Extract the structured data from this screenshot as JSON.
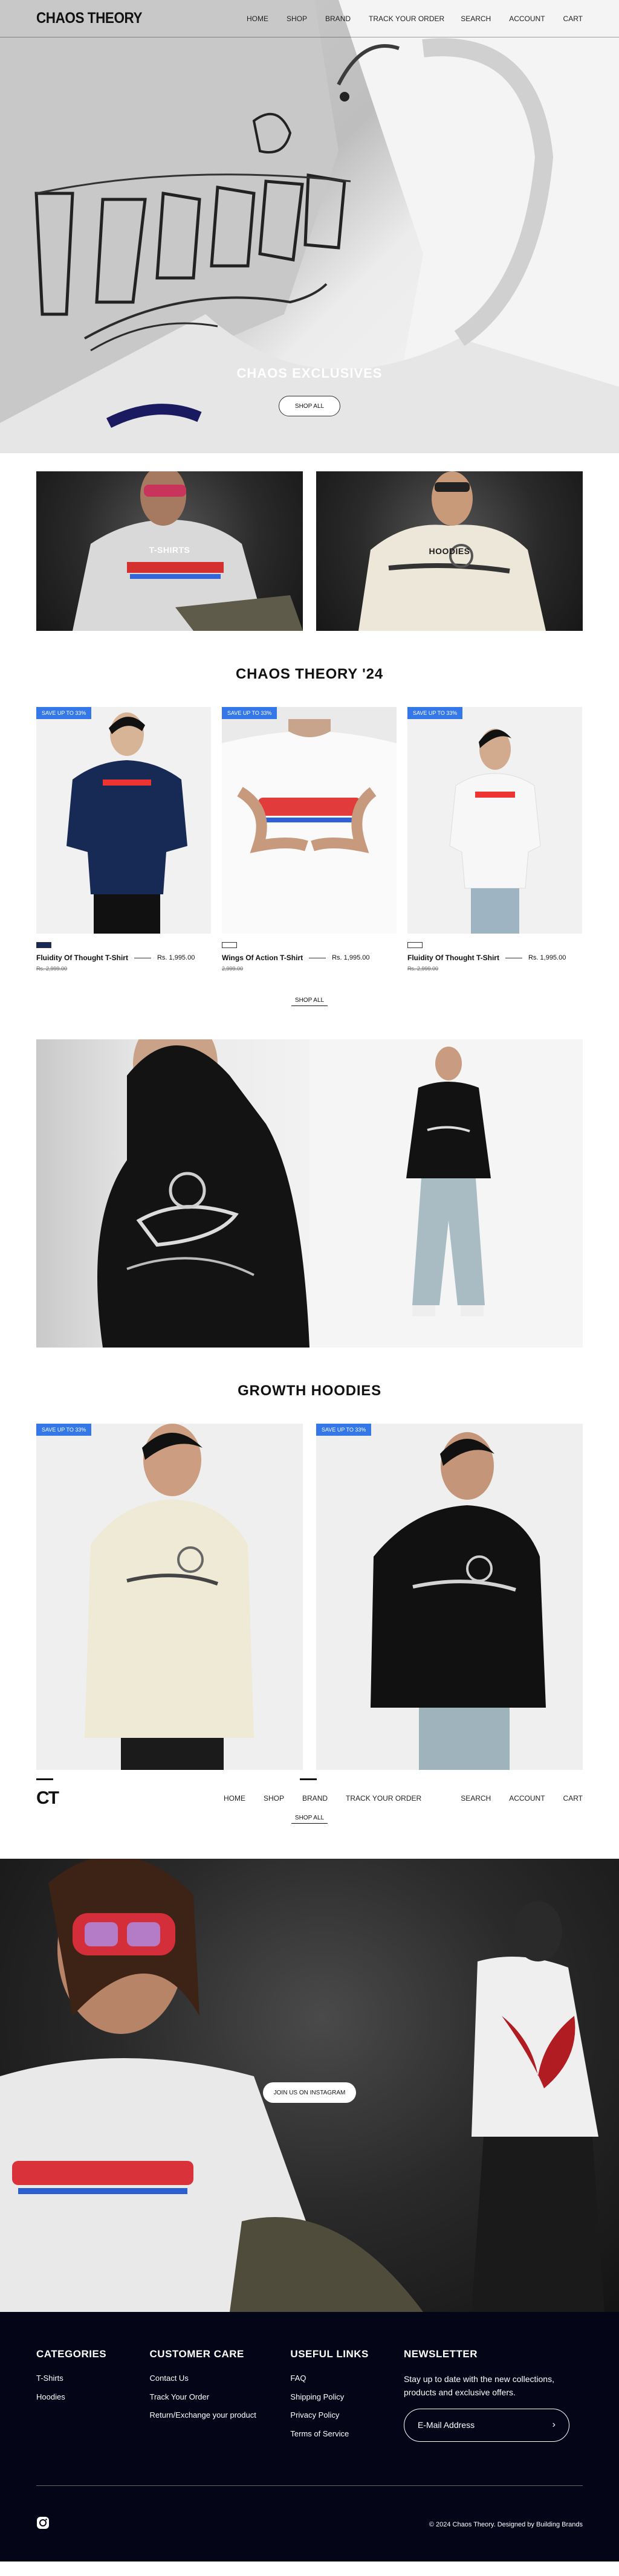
{
  "header": {
    "logo": "CHAOS THEORY",
    "nav": [
      "HOME",
      "SHOP",
      "BRAND",
      "TRACK YOUR ORDER"
    ],
    "utility": [
      "SEARCH",
      "ACCOUNT",
      "CART"
    ]
  },
  "hero": {
    "title": "CHAOS EXCLUSIVES",
    "button": "SHOP ALL"
  },
  "categories": [
    {
      "label": "T-SHIRTS"
    },
    {
      "label": "HOODIES"
    }
  ],
  "collection": {
    "title": "CHAOS THEORY '24",
    "shop_all": "SHOP ALL",
    "products": [
      {
        "badge": "SAVE UP TO 33%",
        "name": "Fluidity Of Thought T-Shirt",
        "price": "Rs. 1,995.00",
        "compare": "Rs. 2,999.00",
        "swatch": "#172a56"
      },
      {
        "badge": "SAVE UP TO 33%",
        "name": "Wings Of Action T-Shirt",
        "price": "Rs. 1,995.00",
        "compare": "2,999.00",
        "swatch": "#ffffff"
      },
      {
        "badge": "SAVE UP TO 33%",
        "name": "Fluidity Of Thought T-Shirt",
        "price": "Rs. 1,995.00",
        "compare": "Rs. 2,999.00",
        "swatch": "#ffffff"
      }
    ]
  },
  "growth": {
    "title": "GROWTH HOODIES",
    "shop_all": "SHOP ALL",
    "products": [
      {
        "badge": "SAVE UP TO 33%"
      },
      {
        "badge": "SAVE UP TO 33%"
      }
    ]
  },
  "subnav": {
    "logo": "CT",
    "nav": [
      "HOME",
      "SHOP",
      "BRAND",
      "TRACK YOUR ORDER"
    ],
    "utility": [
      "SEARCH",
      "ACCOUNT",
      "CART"
    ]
  },
  "instagram": {
    "button": "JOIN US ON INSTAGRAM"
  },
  "footer": {
    "categories": {
      "title": "CATEGORIES",
      "items": [
        "T-Shirts",
        "Hoodies"
      ]
    },
    "customer_care": {
      "title": "CUSTOMER CARE",
      "items": [
        "Contact Us",
        "Track Your Order",
        "Return/Exchange your product"
      ]
    },
    "useful_links": {
      "title": "USEFUL LINKS",
      "items": [
        "FAQ",
        "Shipping Policy",
        "Privacy Policy",
        "Terms of Service"
      ]
    },
    "newsletter": {
      "title": "NEWSLETTER",
      "intro": "Stay up to date with the new collections, products and exclusive offers.",
      "placeholder": "E-Mail Address"
    },
    "copyright": "© 2024 Chaos Theory. Designed by Building Brands"
  },
  "colors": {
    "badge": "#3377e8",
    "footer_bg": "#050518",
    "navy_tee": "#172a56"
  }
}
